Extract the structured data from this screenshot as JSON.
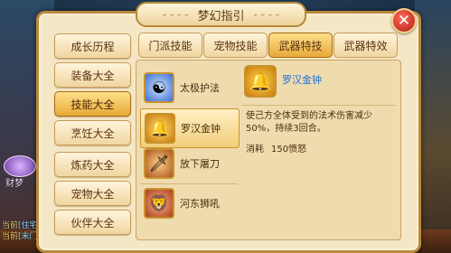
{
  "window": {
    "title": "梦幻指引",
    "close_label": "✕"
  },
  "categories": [
    {
      "label": "成长历程",
      "active": false
    },
    {
      "label": "装备大全",
      "active": false
    },
    {
      "label": "技能大全",
      "active": true
    },
    {
      "label": "烹饪大全",
      "active": false
    },
    {
      "label": "炼药大全",
      "active": false
    },
    {
      "label": "宠物大全",
      "active": false
    },
    {
      "label": "伙伴大全",
      "active": false
    }
  ],
  "tabs": [
    {
      "label": "门派技能",
      "active": false
    },
    {
      "label": "宠物技能",
      "active": false
    },
    {
      "label": "武器特技",
      "active": true
    },
    {
      "label": "武器特效",
      "active": false
    }
  ],
  "skills": [
    {
      "name": "太极护法",
      "icon": "taiji-icon",
      "active": false
    },
    {
      "name": "罗汉金钟",
      "icon": "golden-bell-icon",
      "active": true
    },
    {
      "name": "放下屠刀",
      "icon": "blade-icon",
      "active": false
    },
    {
      "name": "河东狮吼",
      "icon": "lion-roar-icon",
      "active": false
    }
  ],
  "detail": {
    "name": "罗汉金钟",
    "icon": "golden-bell-icon",
    "description": "使己方全体受到的法术伤害减少50%，持续3回合。",
    "cost_label": "消耗",
    "cost_value": "150愤怒"
  },
  "hud": {
    "player_name": "财梦",
    "chat": [
      {
        "channel": "当前",
        "text": "[住宅"
      },
      {
        "channel": "当前",
        "text": "[末门"
      }
    ]
  }
}
